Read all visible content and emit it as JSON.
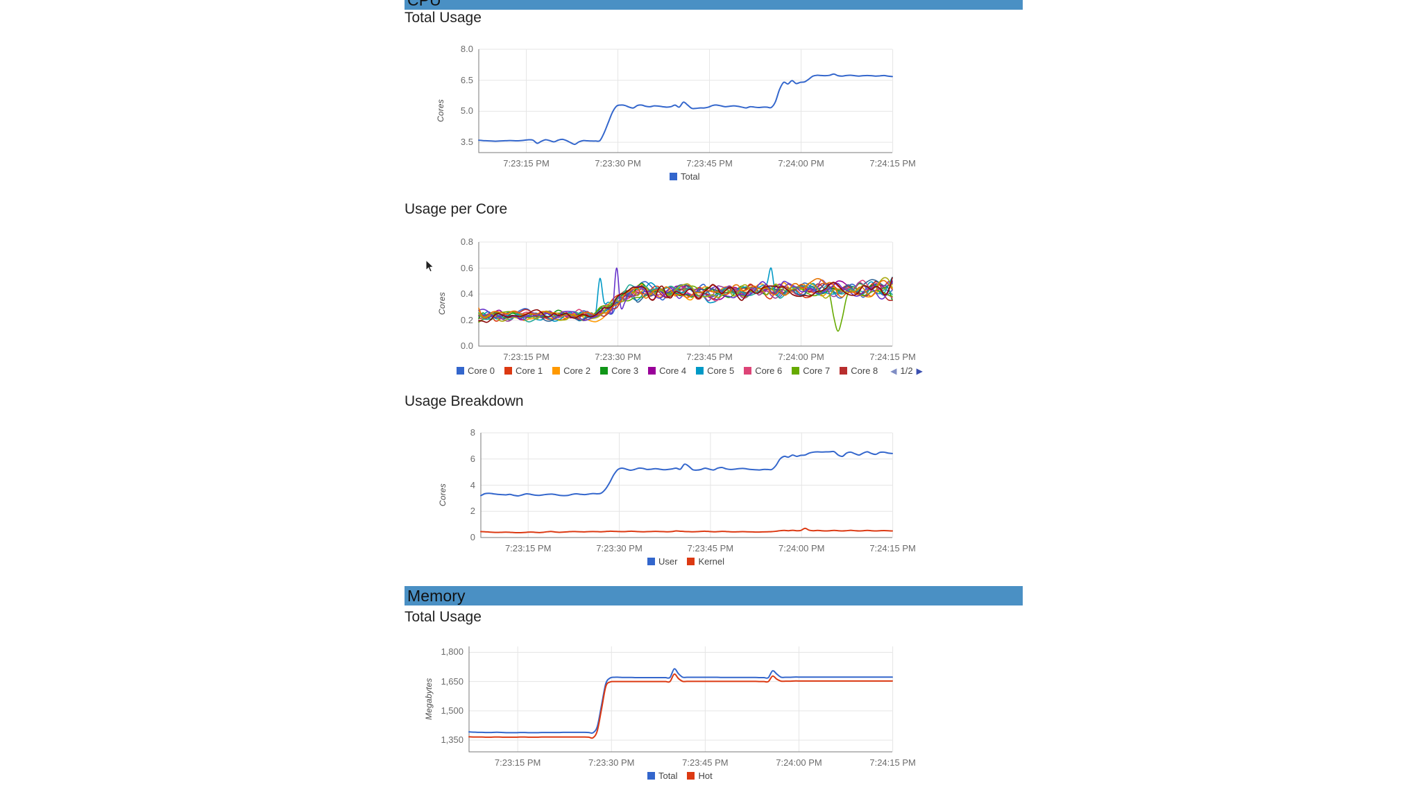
{
  "sections": [
    {
      "id": "cpu",
      "title": "CPU",
      "banner_color": "#4a90c4"
    },
    {
      "id": "memory",
      "title": "Memory",
      "banner_color": "#4a90c4"
    }
  ],
  "subtitles": {
    "cpu_total": "Total Usage",
    "cpu_per_core": "Usage per Core",
    "cpu_breakdown": "Usage Breakdown",
    "mem_total": "Total Usage"
  },
  "pager": {
    "left_arrow": "◀",
    "label": "1/2",
    "right_arrow": "▶"
  },
  "palette": {
    "core0": "#3366cc",
    "core1": "#dc3912",
    "core2": "#ff9900",
    "core3": "#109618",
    "core4": "#990099",
    "core5": "#0099c6",
    "core6": "#dd4477",
    "core7": "#66aa00",
    "core8": "#b82e2e",
    "core9": "#316395",
    "core10": "#994499",
    "core11": "#22aa99",
    "core12": "#aaaa11",
    "core13": "#6633cc",
    "core14": "#e67300",
    "core15": "#8b0707",
    "user": "#3366cc",
    "kernel": "#dc3912",
    "total": "#3366cc",
    "hot": "#dc3912",
    "grid": "#e5e5e5",
    "axis": "#333333",
    "tick_text": "#6b6b6b"
  },
  "chart_data": [
    {
      "id": "cpu-total-usage",
      "type": "line",
      "title": "Total Usage",
      "xlabel": "",
      "ylabel": "Cores",
      "ylim": [
        3.0,
        8.0
      ],
      "yticks": [
        "8.0",
        "6.5",
        "5.0",
        "3.5"
      ],
      "ytick_values": [
        8.0,
        6.5,
        5.0,
        3.5
      ],
      "xticks": [
        "7:23:15 PM",
        "7:23:30 PM",
        "7:23:45 PM",
        "7:24:00 PM",
        "7:24:15 PM"
      ],
      "grid": true,
      "legend_position": "bottom",
      "series": [
        {
          "name": "Total",
          "color": "#3366cc",
          "values": [
            3.6,
            3.58,
            3.57,
            3.56,
            3.55,
            3.56,
            3.57,
            3.58,
            3.58,
            3.57,
            3.58,
            3.6,
            3.62,
            3.6,
            3.45,
            3.55,
            3.62,
            3.58,
            3.52,
            3.6,
            3.64,
            3.58,
            3.48,
            3.4,
            3.52,
            3.58,
            3.57,
            3.56,
            3.56,
            3.58,
            3.95,
            4.45,
            4.95,
            5.25,
            5.3,
            5.28,
            5.2,
            5.16,
            5.28,
            5.3,
            5.24,
            5.22,
            5.26,
            5.25,
            5.22,
            5.2,
            5.22,
            5.3,
            5.2,
            5.44,
            5.3,
            5.14,
            5.14,
            5.16,
            5.16,
            5.2,
            5.28,
            5.3,
            5.26,
            5.22,
            5.24,
            5.26,
            5.24,
            5.2,
            5.16,
            5.22,
            5.2,
            5.18,
            5.2,
            5.2,
            5.18,
            5.45,
            6.05,
            6.4,
            6.32,
            6.48,
            6.34,
            6.4,
            6.42,
            6.55,
            6.7,
            6.74,
            6.73,
            6.72,
            6.74,
            6.8,
            6.72,
            6.7,
            6.73,
            6.74,
            6.72,
            6.7,
            6.72,
            6.73,
            6.72,
            6.7,
            6.71,
            6.73,
            6.7,
            6.68
          ]
        }
      ]
    },
    {
      "id": "cpu-usage-per-core",
      "type": "line",
      "title": "Usage per Core",
      "xlabel": "",
      "ylabel": "Cores",
      "ylim": [
        0.0,
        0.8
      ],
      "yticks": [
        "0.8",
        "0.6",
        "0.4",
        "0.2",
        "0.0"
      ],
      "ytick_values": [
        0.8,
        0.6,
        0.4,
        0.2,
        0.0
      ],
      "xticks": [
        "7:23:15 PM",
        "7:23:30 PM",
        "7:23:45 PM",
        "7:24:00 PM",
        "7:24:15 PM"
      ],
      "grid": true,
      "legend_position": "bottom",
      "legend_paged": true,
      "legend_page": "1/2",
      "series": [
        {
          "name": "Core 0",
          "color": "#3366cc"
        },
        {
          "name": "Core 1",
          "color": "#dc3912"
        },
        {
          "name": "Core 2",
          "color": "#ff9900"
        },
        {
          "name": "Core 3",
          "color": "#109618"
        },
        {
          "name": "Core 4",
          "color": "#990099"
        },
        {
          "name": "Core 5",
          "color": "#0099c6"
        },
        {
          "name": "Core 6",
          "color": "#dd4477"
        },
        {
          "name": "Core 7",
          "color": "#66aa00"
        },
        {
          "name": "Core 8",
          "color": "#b82e2e"
        }
      ],
      "noise_band_before": [
        0.15,
        0.33
      ],
      "noise_band_after": [
        0.3,
        0.6
      ],
      "note": "16 overlapping noisy core traces; values roughly 0.15-0.45 before 7:23:30 and 0.30-0.65 after"
    },
    {
      "id": "cpu-usage-breakdown",
      "type": "line",
      "title": "Usage Breakdown",
      "xlabel": "",
      "ylabel": "Cores",
      "ylim": [
        0,
        8
      ],
      "yticks": [
        "8",
        "6",
        "4",
        "2",
        "0"
      ],
      "ytick_values": [
        8,
        6,
        4,
        2,
        0
      ],
      "xticks": [
        "7:23:15 PM",
        "7:23:30 PM",
        "7:23:45 PM",
        "7:24:00 PM",
        "7:24:15 PM"
      ],
      "grid": true,
      "legend_position": "bottom",
      "series": [
        {
          "name": "User",
          "color": "#3366cc",
          "values": [
            3.2,
            3.35,
            3.38,
            3.34,
            3.3,
            3.28,
            3.26,
            3.3,
            3.22,
            3.18,
            3.26,
            3.34,
            3.3,
            3.24,
            3.22,
            3.26,
            3.3,
            3.32,
            3.28,
            3.22,
            3.2,
            3.22,
            3.3,
            3.34,
            3.3,
            3.28,
            3.32,
            3.36,
            3.34,
            3.4,
            3.7,
            4.2,
            4.8,
            5.2,
            5.3,
            5.22,
            5.14,
            5.2,
            5.3,
            5.28,
            5.2,
            5.22,
            5.26,
            5.22,
            5.18,
            5.2,
            5.24,
            5.3,
            5.22,
            5.6,
            5.45,
            5.18,
            5.15,
            5.2,
            5.3,
            5.22,
            5.16,
            5.3,
            5.35,
            5.25,
            5.2,
            5.22,
            5.26,
            5.28,
            5.24,
            5.2,
            5.18,
            5.16,
            5.2,
            5.2,
            5.2,
            5.5,
            6.0,
            6.2,
            6.14,
            6.3,
            6.2,
            6.28,
            6.3,
            6.45,
            6.52,
            6.54,
            6.53,
            6.54,
            6.55,
            6.56,
            6.3,
            6.2,
            6.45,
            6.52,
            6.4,
            6.3,
            6.45,
            6.55,
            6.42,
            6.35,
            6.5,
            6.52,
            6.45,
            6.42
          ]
        },
        {
          "name": "Kernel",
          "color": "#dc3912",
          "values": [
            0.45,
            0.44,
            0.42,
            0.4,
            0.39,
            0.4,
            0.41,
            0.4,
            0.38,
            0.37,
            0.38,
            0.4,
            0.42,
            0.4,
            0.38,
            0.4,
            0.44,
            0.46,
            0.42,
            0.4,
            0.42,
            0.44,
            0.46,
            0.45,
            0.44,
            0.43,
            0.45,
            0.46,
            0.45,
            0.44,
            0.46,
            0.48,
            0.47,
            0.46,
            0.45,
            0.46,
            0.48,
            0.47,
            0.45,
            0.44,
            0.45,
            0.46,
            0.47,
            0.46,
            0.45,
            0.44,
            0.46,
            0.5,
            0.48,
            0.46,
            0.45,
            0.44,
            0.45,
            0.47,
            0.48,
            0.46,
            0.44,
            0.45,
            0.47,
            0.46,
            0.44,
            0.43,
            0.44,
            0.45,
            0.44,
            0.43,
            0.42,
            0.42,
            0.43,
            0.44,
            0.45,
            0.48,
            0.52,
            0.54,
            0.52,
            0.55,
            0.52,
            0.54,
            0.7,
            0.56,
            0.52,
            0.54,
            0.52,
            0.5,
            0.52,
            0.54,
            0.52,
            0.5,
            0.52,
            0.55,
            0.52,
            0.5,
            0.52,
            0.54,
            0.52,
            0.5,
            0.52,
            0.53,
            0.52,
            0.5
          ]
        }
      ]
    },
    {
      "id": "memory-total-usage",
      "type": "line",
      "title": "Total Usage",
      "xlabel": "",
      "ylabel": "Megabytes",
      "ylim": [
        1290,
        1830
      ],
      "yticks": [
        "1,800",
        "1,650",
        "1,500",
        "1,350"
      ],
      "ytick_values": [
        1800,
        1650,
        1500,
        1350
      ],
      "xticks": [
        "7:23:15 PM",
        "7:23:30 PM",
        "7:23:45 PM",
        "7:24:00 PM",
        "7:24:15 PM"
      ],
      "grid": true,
      "legend_position": "bottom",
      "series": [
        {
          "name": "Total",
          "color": "#3366cc",
          "values": [
            1392,
            1391,
            1390,
            1390,
            1389,
            1389,
            1390,
            1390,
            1389,
            1388,
            1388,
            1388,
            1389,
            1389,
            1388,
            1388,
            1388,
            1389,
            1389,
            1389,
            1389,
            1389,
            1390,
            1390,
            1390,
            1390,
            1390,
            1390,
            1389,
            1388,
            1420,
            1530,
            1640,
            1668,
            1672,
            1672,
            1671,
            1671,
            1671,
            1670,
            1670,
            1670,
            1670,
            1670,
            1670,
            1670,
            1670,
            1671,
            1715,
            1690,
            1672,
            1672,
            1672,
            1672,
            1672,
            1672,
            1672,
            1672,
            1672,
            1671,
            1671,
            1671,
            1671,
            1671,
            1671,
            1671,
            1671,
            1671,
            1670,
            1670,
            1670,
            1705,
            1688,
            1672,
            1672,
            1672,
            1673,
            1673,
            1673,
            1673,
            1673,
            1673,
            1673,
            1673,
            1673,
            1673,
            1673,
            1673,
            1673,
            1673,
            1673,
            1673,
            1673,
            1673,
            1673,
            1673,
            1673,
            1673,
            1673,
            1673
          ]
        },
        {
          "name": "Hot",
          "color": "#dc3912",
          "values": [
            1367,
            1366,
            1366,
            1366,
            1365,
            1365,
            1366,
            1366,
            1365,
            1365,
            1365,
            1365,
            1366,
            1366,
            1365,
            1365,
            1365,
            1366,
            1366,
            1366,
            1366,
            1366,
            1366,
            1366,
            1366,
            1366,
            1366,
            1366,
            1365,
            1362,
            1398,
            1510,
            1625,
            1648,
            1650,
            1650,
            1650,
            1650,
            1650,
            1650,
            1650,
            1650,
            1650,
            1650,
            1650,
            1650,
            1650,
            1650,
            1688,
            1665,
            1651,
            1651,
            1651,
            1651,
            1651,
            1651,
            1651,
            1651,
            1651,
            1651,
            1651,
            1651,
            1651,
            1651,
            1651,
            1651,
            1651,
            1651,
            1650,
            1650,
            1650,
            1678,
            1662,
            1652,
            1652,
            1652,
            1653,
            1653,
            1653,
            1653,
            1653,
            1653,
            1653,
            1653,
            1653,
            1653,
            1653,
            1653,
            1653,
            1653,
            1653,
            1653,
            1653,
            1653,
            1653,
            1653,
            1653,
            1653,
            1653,
            1653
          ]
        }
      ]
    }
  ]
}
